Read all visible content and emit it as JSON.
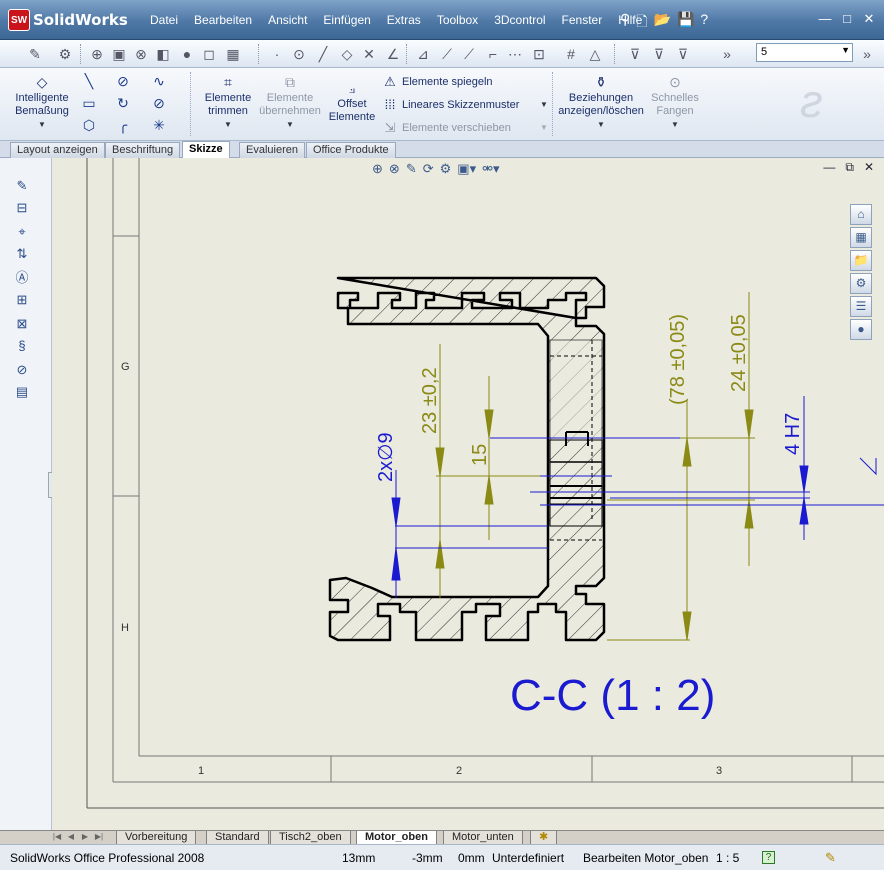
{
  "app": {
    "name": "SolidWorks",
    "logo_badge": "SW"
  },
  "menu": [
    "Datei",
    "Bearbeiten",
    "Ansicht",
    "Einfügen",
    "Extras",
    "Toolbox",
    "3Dcontrol",
    "Fenster",
    "Hilfe"
  ],
  "toolbar2": {
    "layer_value": "5"
  },
  "command_manager": {
    "smart_dimension": "Intelligente\nBemaßung",
    "trim": "Elemente\ntrimmen",
    "convert": "Elemente\nübernehmen",
    "offset": "Offset\nElemente",
    "mirror": "Elemente spiegeln",
    "linear_pattern": "Lineares Skizzenmuster",
    "move": "Elemente verschieben",
    "relations": "Beziehungen\nanzeigen/löschen",
    "quick_snaps": "Schnelles\nFangen"
  },
  "cm_tabs": [
    "Layout anzeigen",
    "Beschriftung",
    "Skizze",
    "Evaluieren",
    "Office Produkte"
  ],
  "cm_tab_active": "Skizze",
  "drawing": {
    "row_g": "G",
    "row_h": "H",
    "col_1": "1",
    "col_2": "2",
    "col_3": "3",
    "view_label": "C-C  (1 : 2)",
    "dim_78": "(78 ±0,05)",
    "dim_24": "24 ±0,05",
    "dim_23": "23 ±0,2",
    "dim_15": "15",
    "dim_2x9": "2x∅9",
    "dim_4h7": "4 H7",
    "color_dim": "#8a8a14",
    "color_blue": "#1a1ad0"
  },
  "sheet_tabs": [
    "Vorbereitung",
    "Standard",
    "Tisch2_oben",
    "Motor_oben",
    "Motor_unten"
  ],
  "sheet_tab_active": "Motor_oben",
  "status": {
    "product": "SolidWorks Office Professional 2008",
    "x": "13mm",
    "y": "-3mm",
    "z": "0mm",
    "state": "Unterdefiniert",
    "editing": "Bearbeiten Motor_oben",
    "scale": "1 : 5"
  }
}
